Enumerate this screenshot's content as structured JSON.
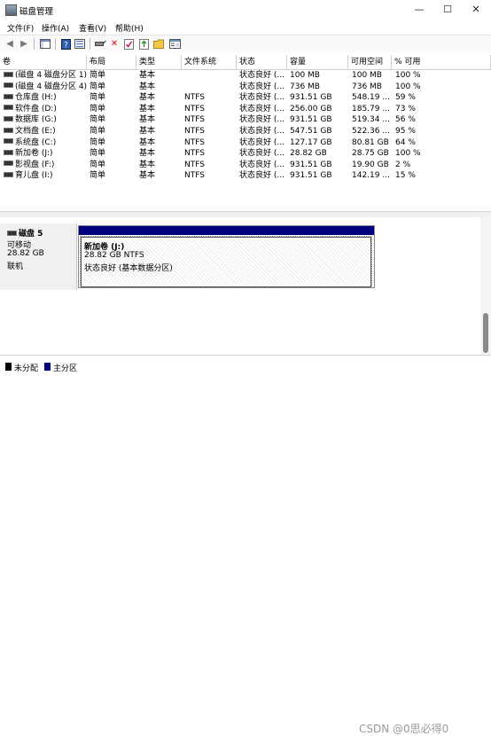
{
  "window": {
    "title": "磁盘管理",
    "controls": {
      "minimize": "—",
      "maximize": "☐",
      "close": "✕"
    }
  },
  "menu": [
    "文件(F)",
    "操作(A)",
    "查看(V)",
    "帮助(H)"
  ],
  "toolbar_icons": [
    "back-icon",
    "forward-icon",
    "console-tree-icon",
    "help-icon",
    "properties-icon",
    "connect-icon",
    "delete-icon",
    "check-icon",
    "export-icon",
    "folder-icon",
    "view-icon"
  ],
  "columns": [
    "卷",
    "布局",
    "类型",
    "文件系统",
    "状态",
    "容量",
    "可用空间",
    "% 可用"
  ],
  "volumes": [
    [
      "(磁盘 4 磁盘分区 1)",
      "简单",
      "基本",
      "",
      "状态良好 (...",
      "100 MB",
      "100 MB",
      "100 %"
    ],
    [
      "(磁盘 4 磁盘分区 4)",
      "简单",
      "基本",
      "",
      "状态良好 (...",
      "736 MB",
      "736 MB",
      "100 %"
    ],
    [
      "仓库盘 (H:)",
      "简单",
      "基本",
      "NTFS",
      "状态良好 (...",
      "931.51 GB",
      "548.19 ...",
      "59 %"
    ],
    [
      "软件盘 (D:)",
      "简单",
      "基本",
      "NTFS",
      "状态良好 (...",
      "256.00 GB",
      "185.79 ...",
      "73 %"
    ],
    [
      "数据库 (G:)",
      "简单",
      "基本",
      "NTFS",
      "状态良好 (...",
      "931.51 GB",
      "519.34 ...",
      "56 %"
    ],
    [
      "文档盘 (E:)",
      "简单",
      "基本",
      "NTFS",
      "状态良好 (...",
      "547.51 GB",
      "522.36 ...",
      "95 %"
    ],
    [
      "系统盘 (C:)",
      "简单",
      "基本",
      "NTFS",
      "状态良好 (...",
      "127.17 GB",
      "80.81 GB",
      "64 %"
    ],
    [
      "新加卷 (J:)",
      "简单",
      "基本",
      "NTFS",
      "状态良好 (...",
      "28.82 GB",
      "28.75 GB",
      "100 %"
    ],
    [
      "影视盘 (F:)",
      "简单",
      "基本",
      "NTFS",
      "状态良好 (...",
      "931.51 GB",
      "19.90 GB",
      "2 %"
    ],
    [
      "育儿盘 (I:)",
      "简单",
      "基本",
      "NTFS",
      "状态良好 (...",
      "931.51 GB",
      "142.19 ...",
      "15 %"
    ]
  ],
  "disk": {
    "name": "磁盘 5",
    "kind": "可移动",
    "size": "28.82 GB",
    "status": "联机"
  },
  "partition": {
    "name": "新加卷 (J:)",
    "size_fs": "28.82 GB NTFS",
    "status": "状态良好 (基本数据分区)",
    "bar_color": "#00007f"
  },
  "legend": [
    {
      "label": "未分配",
      "color": "#000000"
    },
    {
      "label": "主分区",
      "color": "#00007f"
    }
  ],
  "watermark": "CSDN @0思必得0"
}
